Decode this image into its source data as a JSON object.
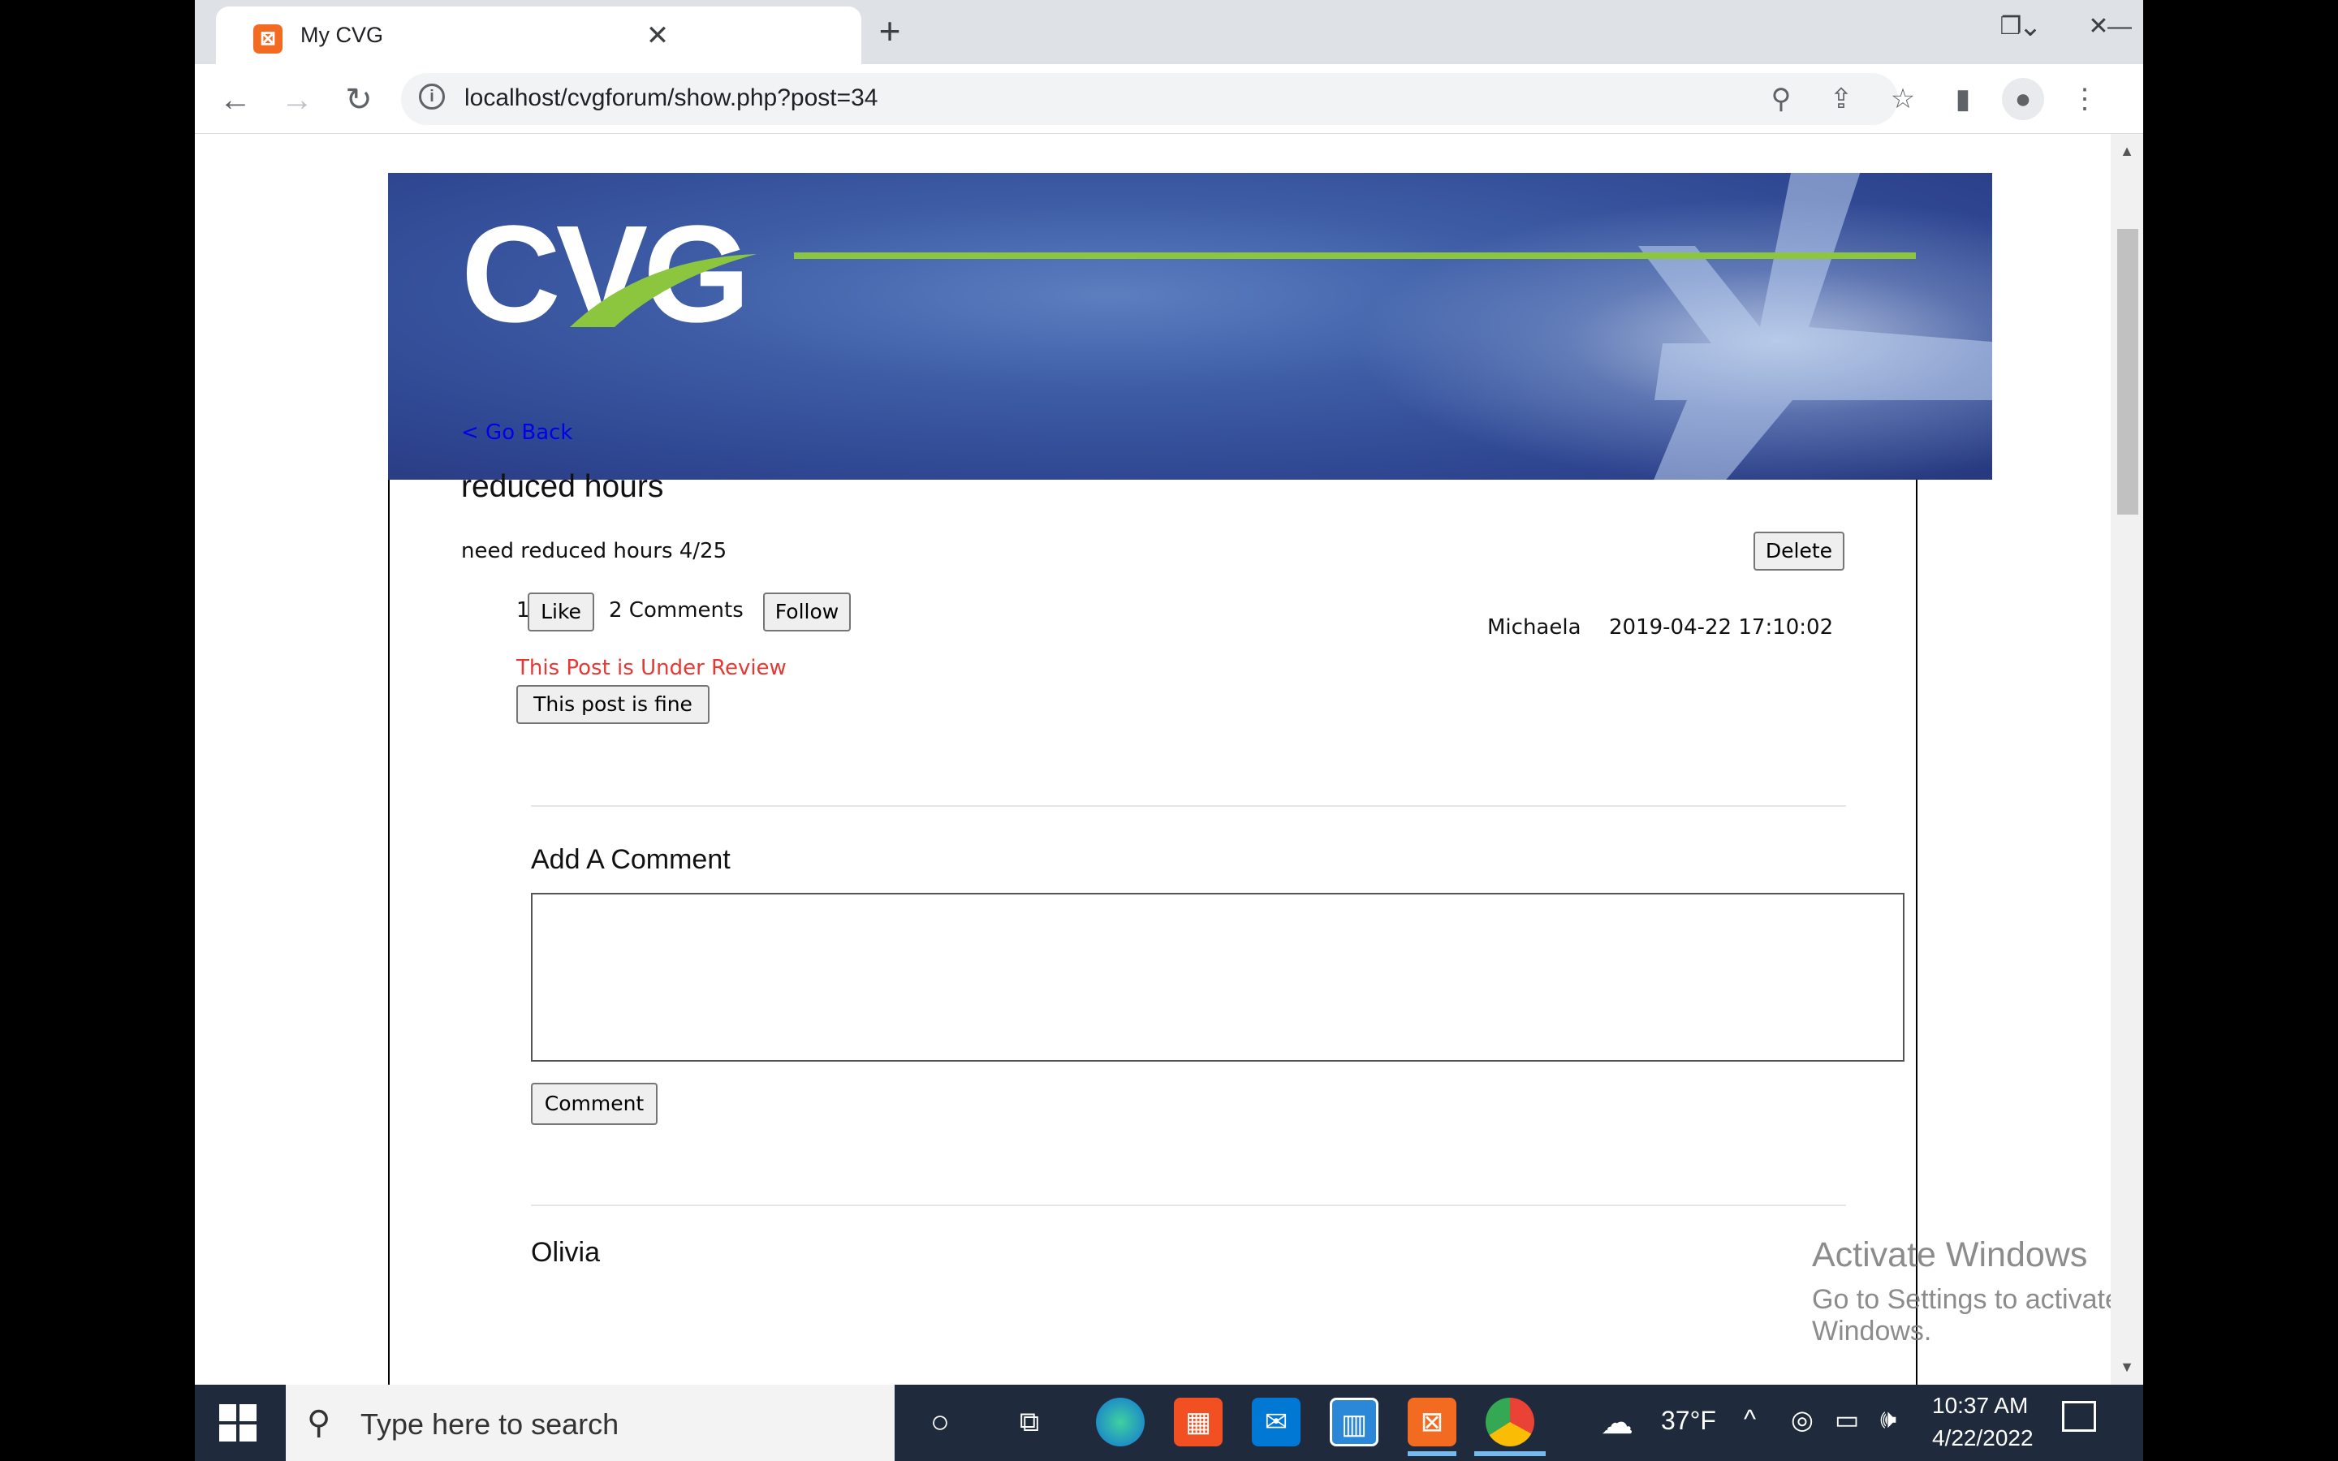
{
  "browser": {
    "tab_title": "My CVG",
    "tab_close": "✕",
    "new_tab": "+",
    "url": "localhost/cvgforum/show.php?post=34",
    "icons": [
      "xampp-favicon",
      "back-icon",
      "forward-icon",
      "reload-icon",
      "info-icon",
      "zoom-icon",
      "share-icon",
      "star-icon",
      "sidepanel-icon",
      "profile-icon",
      "menu-icon"
    ],
    "window_controls": {
      "dropdown": "⌄",
      "minimize": "—",
      "restore": "❐",
      "close": "✕"
    }
  },
  "banner": {
    "logo_text": "CVG",
    "line_color": "#8cc63f",
    "background_color": "#2e4590"
  },
  "post": {
    "back_link": "< Go Back",
    "title": "reduced hours",
    "body": "need reduced hours 4/25",
    "delete_label": "Delete",
    "like_count": "1",
    "like_label": "Like",
    "comments_count": "2 Comments",
    "follow_label": "Follow",
    "author": "Michaela",
    "timestamp": "2019-04-22 17:10:02",
    "review_status": "This Post is Under Review",
    "review_status_color": "#e53935",
    "approve_label": "This post is fine"
  },
  "comment_form": {
    "title": "Add A Comment",
    "value": "",
    "submit_label": "Comment"
  },
  "next_comment_author_partial": "Olivia",
  "watermark": {
    "title": "Activate Windows",
    "subtitle": "Go to Settings to activate Windows."
  },
  "taskbar": {
    "search_placeholder": "Type here to search",
    "apps": [
      "cortana-icon",
      "task-view-icon",
      "edge-icon",
      "store-icon",
      "mail-icon",
      "app-icon",
      "xampp-icon",
      "chrome-icon"
    ],
    "weather": "37°F",
    "time": "10:37 AM",
    "date": "4/22/2022"
  }
}
